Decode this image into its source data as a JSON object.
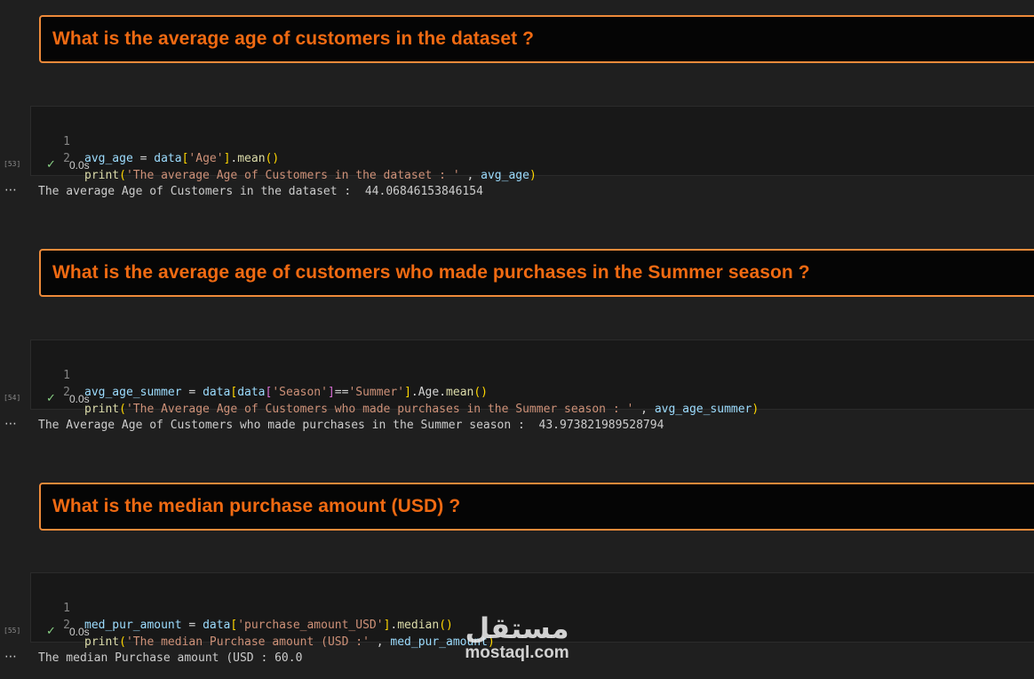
{
  "cells": [
    {
      "heading": "What is the average age of customers in the dataset ?",
      "exec_count": "[53]",
      "status_time": "0.0s",
      "line_numbers": [
        "1",
        "2"
      ],
      "output_marker": "⋯",
      "output": "The average Age of Customers in the dataset :  44.06846153846154",
      "tokens": {
        "l1_var": "avg_age",
        "l1_eq": " = ",
        "l1_data": "data",
        "l1_br_open": "[",
        "l1_str": "'Age'",
        "l1_br_close": "]",
        "l1_dot": ".",
        "l1_fn": "mean",
        "l1_par": "()",
        "l2_fn": "print",
        "l2_par_open": "(",
        "l2_str": "'The average Age of Customers in the dataset : '",
        "l2_comma": " , ",
        "l2_var": "avg_age",
        "l2_par_close": ")"
      }
    },
    {
      "heading": "What is the average age of customers who made purchases in the Summer season ?",
      "exec_count": "[54]",
      "status_time": "0.0s",
      "line_numbers": [
        "1",
        "2"
      ],
      "output_marker": "⋯",
      "output": "The Average Age of Customers who made purchases in the Summer season :  43.973821989528794",
      "tokens": {
        "l1_var": "avg_age_summer",
        "l1_eq": " = ",
        "l1_data": "data",
        "l1_br_open": "[",
        "l1_data2": "data",
        "l1_br2_open": "[",
        "l1_str": "'Season'",
        "l1_br2_close": "]",
        "l1_op": "==",
        "l1_str2": "'Summer'",
        "l1_br_close": "]",
        "l1_attr": ".Age.",
        "l1_fn": "mean",
        "l1_par": "()",
        "l2_fn": "print",
        "l2_par_open": "(",
        "l2_str": "'The Average Age of Customers who made purchases in the Summer season : '",
        "l2_comma": " , ",
        "l2_var": "avg_age_summer",
        "l2_par_close": ")"
      }
    },
    {
      "heading": "What is the median purchase amount (USD) ?",
      "exec_count": "[55]",
      "status_time": "0.0s",
      "line_numbers": [
        "1",
        "2"
      ],
      "output_marker": "⋯",
      "output": "The median Purchase amount (USD : 60.0",
      "tokens": {
        "l1_var": "med_pur_amount",
        "l1_eq": " = ",
        "l1_data": "data",
        "l1_br_open": "[",
        "l1_str": "'purchase_amount_USD'",
        "l1_br_close": "]",
        "l1_dot": ".",
        "l1_fn": "median",
        "l1_par": "()",
        "l2_fn": "print",
        "l2_par_open": "(",
        "l2_str": "'The median Purchase amount (USD :'",
        "l2_comma": " , ",
        "l2_var": "med_pur_amount",
        "l2_par_close": ")"
      }
    }
  ],
  "watermark": {
    "arabic": "مستقل",
    "latin": "mostaql.com"
  },
  "colors": {
    "heading": "#f06a12",
    "heading_border": "#ee8a3a",
    "check": "#89d185",
    "variable": "#9cdcfe",
    "function": "#dcdcaa",
    "string": "#ce9178"
  },
  "icons": {
    "status": "check-icon",
    "output": "ellipsis-icon"
  }
}
